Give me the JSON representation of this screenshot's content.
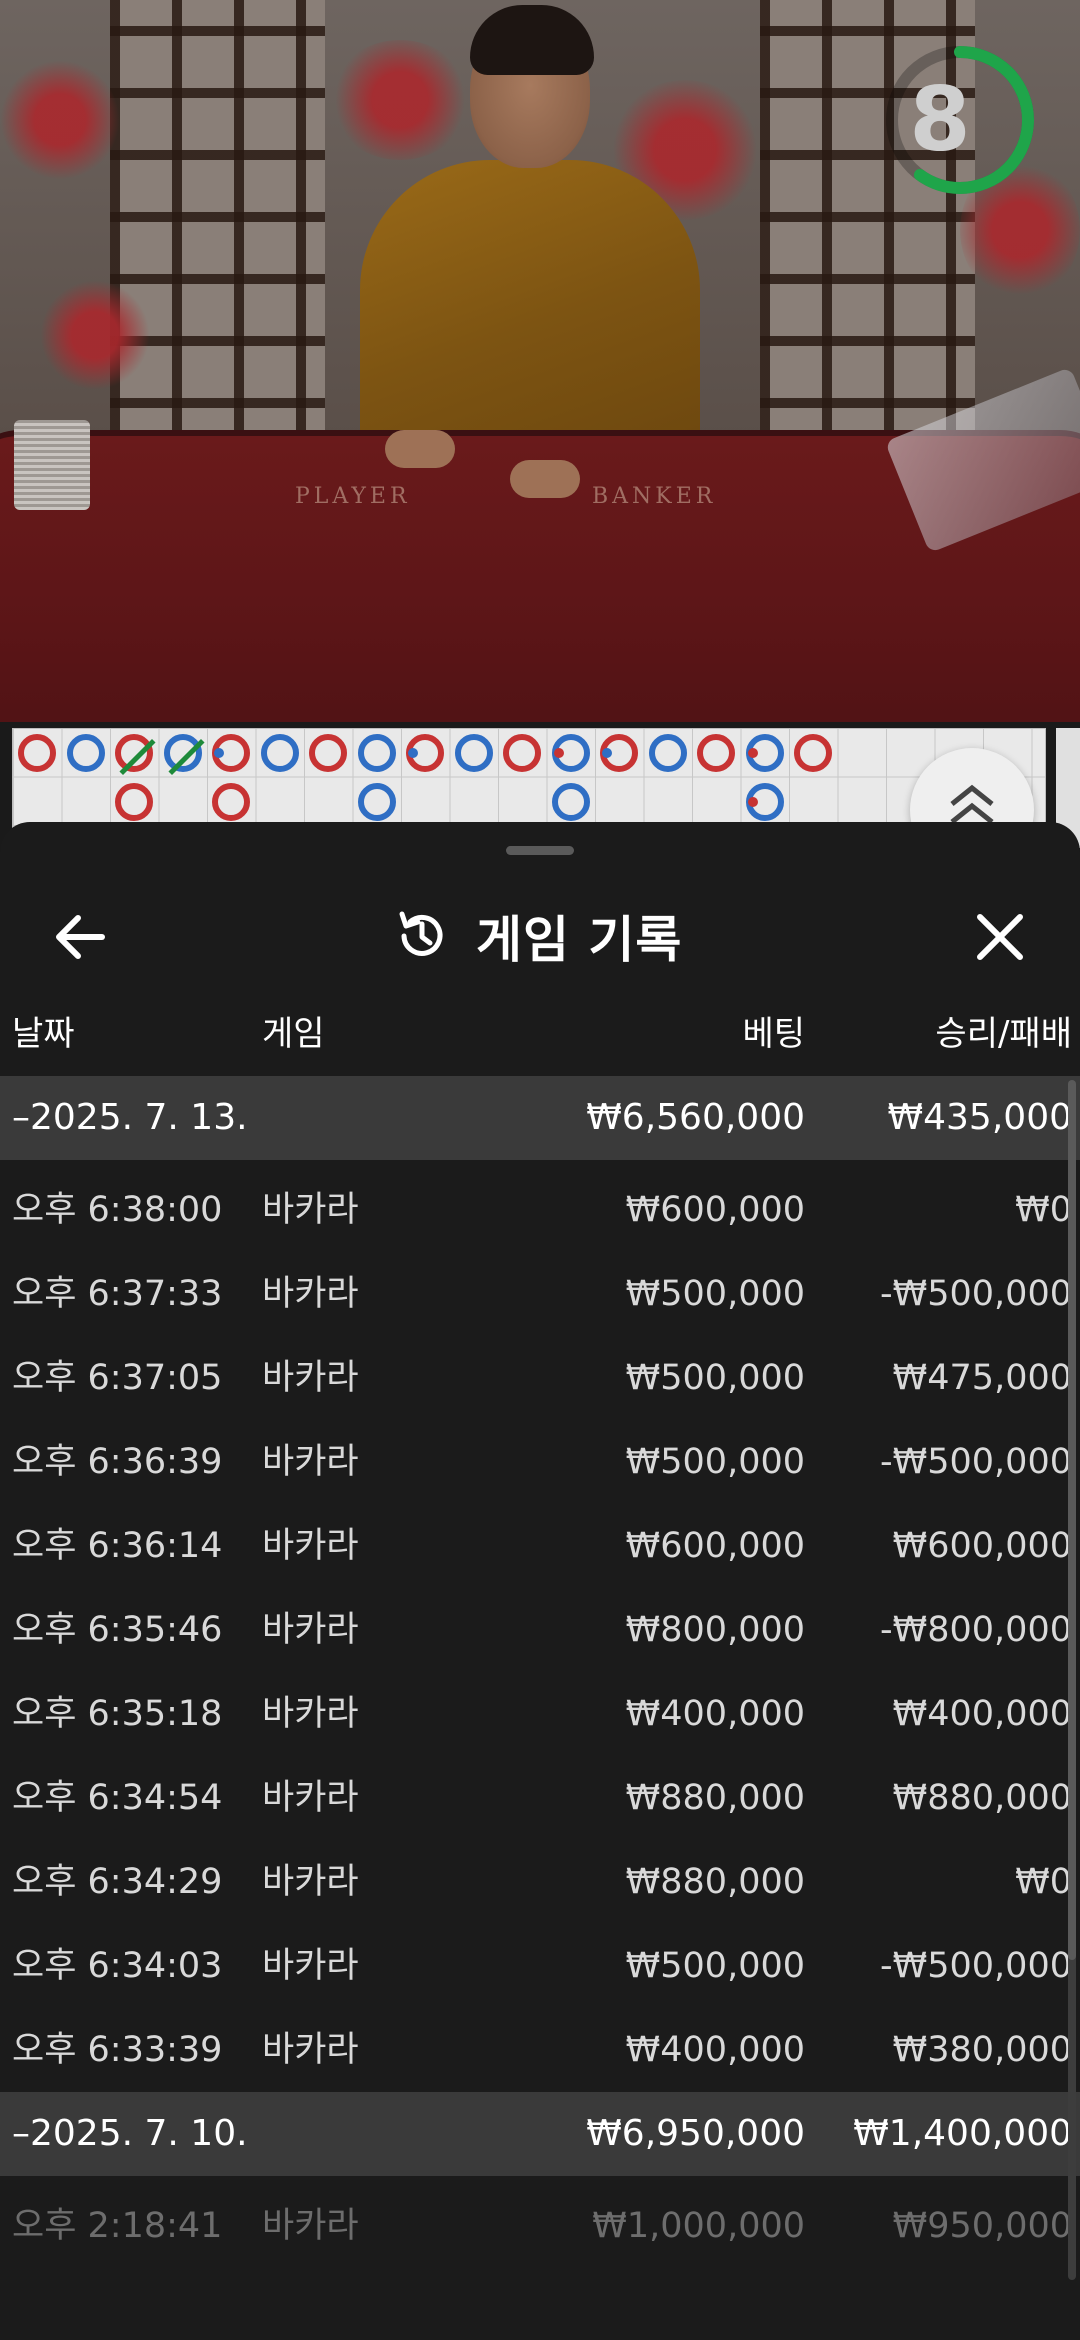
{
  "timer": {
    "value": "8",
    "remaining_fraction": 0.6,
    "color": "#1fa54a"
  },
  "table": {
    "player_label": "PLAYER",
    "banker_label": "BANKER"
  },
  "roadmap": {
    "colors": {
      "banker": "#c73333",
      "player": "#2f6ec4",
      "tie": "#1e8a3a"
    },
    "beads": [
      {
        "col": 0,
        "row": 0,
        "side": "banker"
      },
      {
        "col": 1,
        "row": 0,
        "side": "player"
      },
      {
        "col": 2,
        "row": 0,
        "side": "banker",
        "tie": true
      },
      {
        "col": 2,
        "row": 1,
        "side": "banker"
      },
      {
        "col": 3,
        "row": 0,
        "side": "player",
        "tie": true
      },
      {
        "col": 4,
        "row": 0,
        "side": "banker",
        "pair": true
      },
      {
        "col": 4,
        "row": 1,
        "side": "banker"
      },
      {
        "col": 5,
        "row": 0,
        "side": "player"
      },
      {
        "col": 6,
        "row": 0,
        "side": "banker"
      },
      {
        "col": 7,
        "row": 0,
        "side": "player"
      },
      {
        "col": 7,
        "row": 1,
        "side": "player"
      },
      {
        "col": 8,
        "row": 0,
        "side": "banker",
        "pair": true
      },
      {
        "col": 9,
        "row": 0,
        "side": "player"
      },
      {
        "col": 10,
        "row": 0,
        "side": "banker"
      },
      {
        "col": 11,
        "row": 0,
        "side": "player",
        "pair": true
      },
      {
        "col": 11,
        "row": 1,
        "side": "player"
      },
      {
        "col": 12,
        "row": 0,
        "side": "banker",
        "pair": true
      },
      {
        "col": 13,
        "row": 0,
        "side": "player"
      },
      {
        "col": 14,
        "row": 0,
        "side": "banker"
      },
      {
        "col": 15,
        "row": 0,
        "side": "player",
        "pair": true
      },
      {
        "col": 15,
        "row": 1,
        "side": "player",
        "pair": true
      },
      {
        "col": 16,
        "row": 0,
        "side": "banker"
      }
    ]
  },
  "sheet": {
    "title": "게임 기록",
    "back_icon": "arrow-left-icon",
    "history_icon": "history-icon",
    "close_icon": "close-icon",
    "columns": {
      "date": "날짜",
      "game": "게임",
      "bet": "베팅",
      "win_loss": "승리/패배"
    }
  },
  "groups": [
    {
      "date": "–2025. 7. 13.",
      "bet_total": "₩6,560,000",
      "win_total": "₩435,000",
      "rows": [
        {
          "time": "오후 6:38:00",
          "game": "바카라",
          "bet": "₩600,000",
          "result": "₩0"
        },
        {
          "time": "오후 6:37:33",
          "game": "바카라",
          "bet": "₩500,000",
          "result": "-₩500,000"
        },
        {
          "time": "오후 6:37:05",
          "game": "바카라",
          "bet": "₩500,000",
          "result": "₩475,000"
        },
        {
          "time": "오후 6:36:39",
          "game": "바카라",
          "bet": "₩500,000",
          "result": "-₩500,000"
        },
        {
          "time": "오후 6:36:14",
          "game": "바카라",
          "bet": "₩600,000",
          "result": "₩600,000"
        },
        {
          "time": "오후 6:35:46",
          "game": "바카라",
          "bet": "₩800,000",
          "result": "-₩800,000"
        },
        {
          "time": "오후 6:35:18",
          "game": "바카라",
          "bet": "₩400,000",
          "result": "₩400,000"
        },
        {
          "time": "오후 6:34:54",
          "game": "바카라",
          "bet": "₩880,000",
          "result": "₩880,000"
        },
        {
          "time": "오후 6:34:29",
          "game": "바카라",
          "bet": "₩880,000",
          "result": "₩0"
        },
        {
          "time": "오후 6:34:03",
          "game": "바카라",
          "bet": "₩500,000",
          "result": "-₩500,000"
        },
        {
          "time": "오후 6:33:39",
          "game": "바카라",
          "bet": "₩400,000",
          "result": "₩380,000"
        }
      ]
    },
    {
      "date": "–2025. 7. 10.",
      "bet_total": "₩6,950,000",
      "win_total": "₩1,400,000",
      "rows": [
        {
          "time": "오후 2:18:41",
          "game": "바카라",
          "bet": "₩1,000,000",
          "result": "₩950,000"
        }
      ]
    }
  ]
}
